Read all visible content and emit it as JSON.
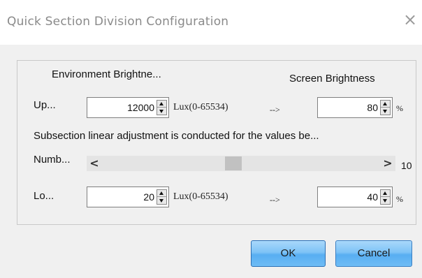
{
  "window": {
    "title": "Quick Section Division Configuration",
    "close_glyph": "×"
  },
  "headers": {
    "environment_brightness": "Environment Brightne...",
    "screen_brightness": "Screen Brightness"
  },
  "upper": {
    "label": "Up...",
    "lux_value": "12000",
    "lux_range": "Lux(0-65534)",
    "arrow": "-->",
    "screen_value": "80",
    "percent": "%"
  },
  "description": "Subsection linear adjustment is conducted for the values be...",
  "number": {
    "label": "Numb...",
    "left_arrow": "<",
    "right_arrow": ">",
    "value": "10"
  },
  "lower": {
    "label": "Lo...",
    "lux_value": "20",
    "lux_range": "Lux(0-65534)",
    "arrow": "-->",
    "screen_value": "40",
    "percent": "%"
  },
  "buttons": {
    "ok": "OK",
    "cancel": "Cancel"
  },
  "colors": {
    "button_blue": "#58aef2",
    "dialog_bg": "#f0f0f0",
    "title_text": "#8a8a8a"
  }
}
